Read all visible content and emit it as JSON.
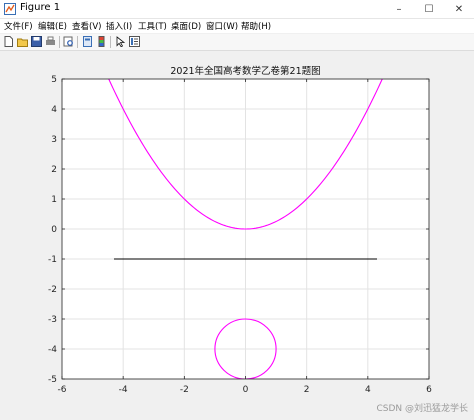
{
  "window": {
    "title": "Figure 1",
    "controls": [
      "–",
      "☐",
      "✕"
    ]
  },
  "menus": [
    "文件(F)",
    "编辑(E)",
    "查看(V)",
    "插入(I)",
    "工具(T)",
    "桌面(D)",
    "窗口(W)",
    "帮助(H)"
  ],
  "toolbar_icons": [
    "new-figure-icon",
    "open-file-icon",
    "save-icon",
    "print-icon",
    "print-preview-icon",
    "link-plot-icon",
    "insert-colorbar-icon",
    "edit-plot-icon",
    "property-inspector-icon"
  ],
  "watermark": "CSDN @刘迅猛龙学长",
  "chart_data": {
    "type": "line",
    "title": "2021年全国高考数学乙卷第21题图",
    "xlabel": "",
    "ylabel": "",
    "xlim": [
      -6,
      6
    ],
    "ylim": [
      -5,
      5
    ],
    "xticks": [
      -6,
      -4,
      -2,
      0,
      2,
      4,
      6
    ],
    "yticks": [
      -5,
      -4,
      -3,
      -2,
      -1,
      0,
      1,
      2,
      3,
      4,
      5
    ],
    "grid": true,
    "series": [
      {
        "kind": "parabola",
        "equation_coeff": 0.25,
        "x_range": [
          -4.5,
          4.5
        ],
        "color": "#ff00ff"
      },
      {
        "kind": "segment",
        "x": [
          -4.3,
          4.3
        ],
        "y": [
          -1,
          -1
        ],
        "color": "#000000"
      },
      {
        "kind": "circle",
        "center": [
          0,
          -4
        ],
        "radius": 1,
        "color": "#ff00ff"
      }
    ]
  }
}
